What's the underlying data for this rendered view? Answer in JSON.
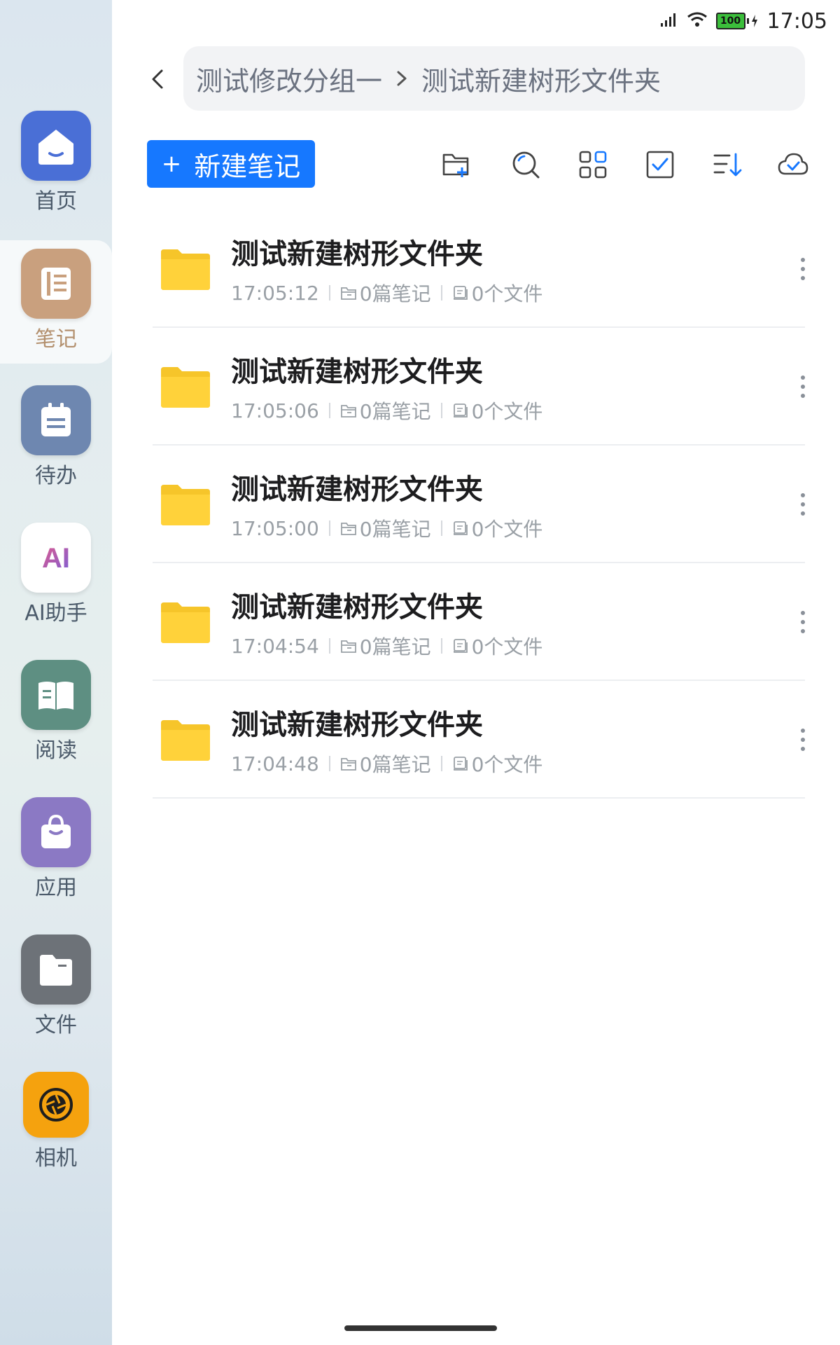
{
  "status": {
    "time": "17:05",
    "battery": "100"
  },
  "sidebar": {
    "items": [
      {
        "label": "首页",
        "icon": "home-icon",
        "color": "#4a6fd6"
      },
      {
        "label": "笔记",
        "icon": "notebook-icon",
        "color": "#c9a07e"
      },
      {
        "label": "待办",
        "icon": "todo-icon",
        "color": "#6e87b0"
      },
      {
        "label": "AI助手",
        "icon": "ai-icon",
        "color": "#ffffff"
      },
      {
        "label": "阅读",
        "icon": "book-icon",
        "color": "#5e8f82"
      },
      {
        "label": "应用",
        "icon": "bag-icon",
        "color": "#8b79c4"
      },
      {
        "label": "文件",
        "icon": "folder-icon",
        "color": "#6d7278"
      },
      {
        "label": "相机",
        "icon": "camera-icon",
        "color": "#f5a20e"
      }
    ],
    "active_index": 1
  },
  "breadcrumb": {
    "parent": "测试修改分组一",
    "current": "测试新建树形文件夹"
  },
  "toolbar": {
    "new_note_label": "新建笔记",
    "new_note_plus": "+",
    "accent": "#1678ff"
  },
  "folders": [
    {
      "name": "测试新建树形文件夹",
      "time": "17:05:12",
      "notes": "0篇笔记",
      "files": "0个文件"
    },
    {
      "name": "测试新建树形文件夹",
      "time": "17:05:06",
      "notes": "0篇笔记",
      "files": "0个文件"
    },
    {
      "name": "测试新建树形文件夹",
      "time": "17:05:00",
      "notes": "0篇笔记",
      "files": "0个文件"
    },
    {
      "name": "测试新建树形文件夹",
      "time": "17:04:54",
      "notes": "0篇笔记",
      "files": "0个文件"
    },
    {
      "name": "测试新建树形文件夹",
      "time": "17:04:48",
      "notes": "0篇笔记",
      "files": "0个文件"
    }
  ],
  "folder_color": "#ffd23a"
}
